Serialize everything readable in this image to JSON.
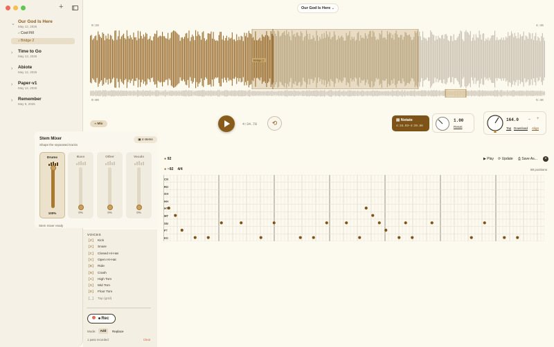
{
  "app": {
    "song_title": "Our God Is Here"
  },
  "sidebar": {
    "songs": [
      {
        "title": "Our God Is Here",
        "date": "May 12, 2026",
        "expanded": true,
        "active": true,
        "sections": [
          {
            "label": "Cool Fill",
            "active": false
          },
          {
            "label": "Bridge 2",
            "active": true
          }
        ]
      },
      {
        "title": "Time to Go",
        "date": "May 13, 2026"
      },
      {
        "title": "Abiote",
        "date": "May 12, 2026"
      },
      {
        "title": "Paper-v1",
        "date": "May 12, 2026"
      },
      {
        "title": "Remember",
        "date": "May 9, 2026"
      }
    ]
  },
  "waveform": {
    "start_time": "0:28",
    "end_time": "4:46",
    "mini_start": "0:00",
    "mini_end": "5:46",
    "region_label": "Bridge 2"
  },
  "transport": {
    "mix_label": "Mix",
    "position": "4:34.78"
  },
  "notate": {
    "label": "Notate",
    "range": "4:34.03–4:39.88"
  },
  "speed": {
    "value": "1.00",
    "reset_label": "Reset"
  },
  "tempo": {
    "bpm": "164.0",
    "tap": "Tap",
    "download": "Download",
    "align": "Align"
  },
  "stem_mixer": {
    "title": "Stem Mixer",
    "subtitle": "Shape the separated tracks",
    "stems_badge": "4 stems",
    "status": "Stem mixer ready",
    "stems": [
      {
        "name": "Drums",
        "level": "100%",
        "fill": 1.0,
        "active": true
      },
      {
        "name": "Bass",
        "level": "0%",
        "fill": 0.0,
        "active": false
      },
      {
        "name": "Other",
        "level": "0%",
        "fill": 0.0,
        "active": false
      },
      {
        "name": "Vocals",
        "level": "0%",
        "fill": 0.0,
        "active": false
      }
    ]
  },
  "notation": {
    "bpm": "92",
    "bpm2": "~92",
    "time_sig": "4/4",
    "positions": "88 positions",
    "play": "Play",
    "update": "Update",
    "save": "Save As...",
    "rows": [
      "CR",
      "RD",
      "OH",
      "HH",
      "HT",
      "MT",
      "SN",
      "FT",
      "KK"
    ],
    "notes": [
      {
        "row": "HT",
        "steps": [
          1,
          61
        ]
      },
      {
        "row": "MT",
        "steps": [
          3,
          63
        ]
      },
      {
        "row": "SN",
        "steps": [
          17,
          23,
          33,
          49,
          55,
          81
        ]
      },
      {
        "row": "SN",
        "steps": [
          65,
          73,
          97
        ]
      },
      {
        "row": "FT",
        "steps": [
          5,
          67
        ]
      },
      {
        "row": "KK",
        "steps": [
          9,
          13,
          29,
          41,
          45,
          59,
          71,
          75,
          93,
          103,
          107
        ]
      }
    ]
  },
  "voices": {
    "title": "VOICES",
    "items": [
      {
        "key": "[Z]",
        "name": "Kick"
      },
      {
        "key": "[X]",
        "name": "Snare"
      },
      {
        "key": "[C]",
        "name": "Closed Hi-Hat"
      },
      {
        "key": "[V]",
        "name": "Open Hi-Hat"
      },
      {
        "key": "[B]",
        "name": "Ride"
      },
      {
        "key": "[N]",
        "name": "Crash"
      },
      {
        "key": "[A]",
        "name": "High Tom"
      },
      {
        "key": "[S]",
        "name": "Mid Tom"
      },
      {
        "key": "[D]",
        "name": "Floor Tom"
      },
      {
        "key": "[_]",
        "name": "Tap (grid)"
      }
    ]
  },
  "record": {
    "label": "Rec",
    "mode_label": "Mode:",
    "add": "Add",
    "replace": "Replace",
    "passes": "1 pass recorded",
    "clear": "Clear"
  },
  "colors": {
    "accent": "#8a5c1c",
    "wave": "#9a6e2e",
    "background": "#fcf9ef"
  }
}
